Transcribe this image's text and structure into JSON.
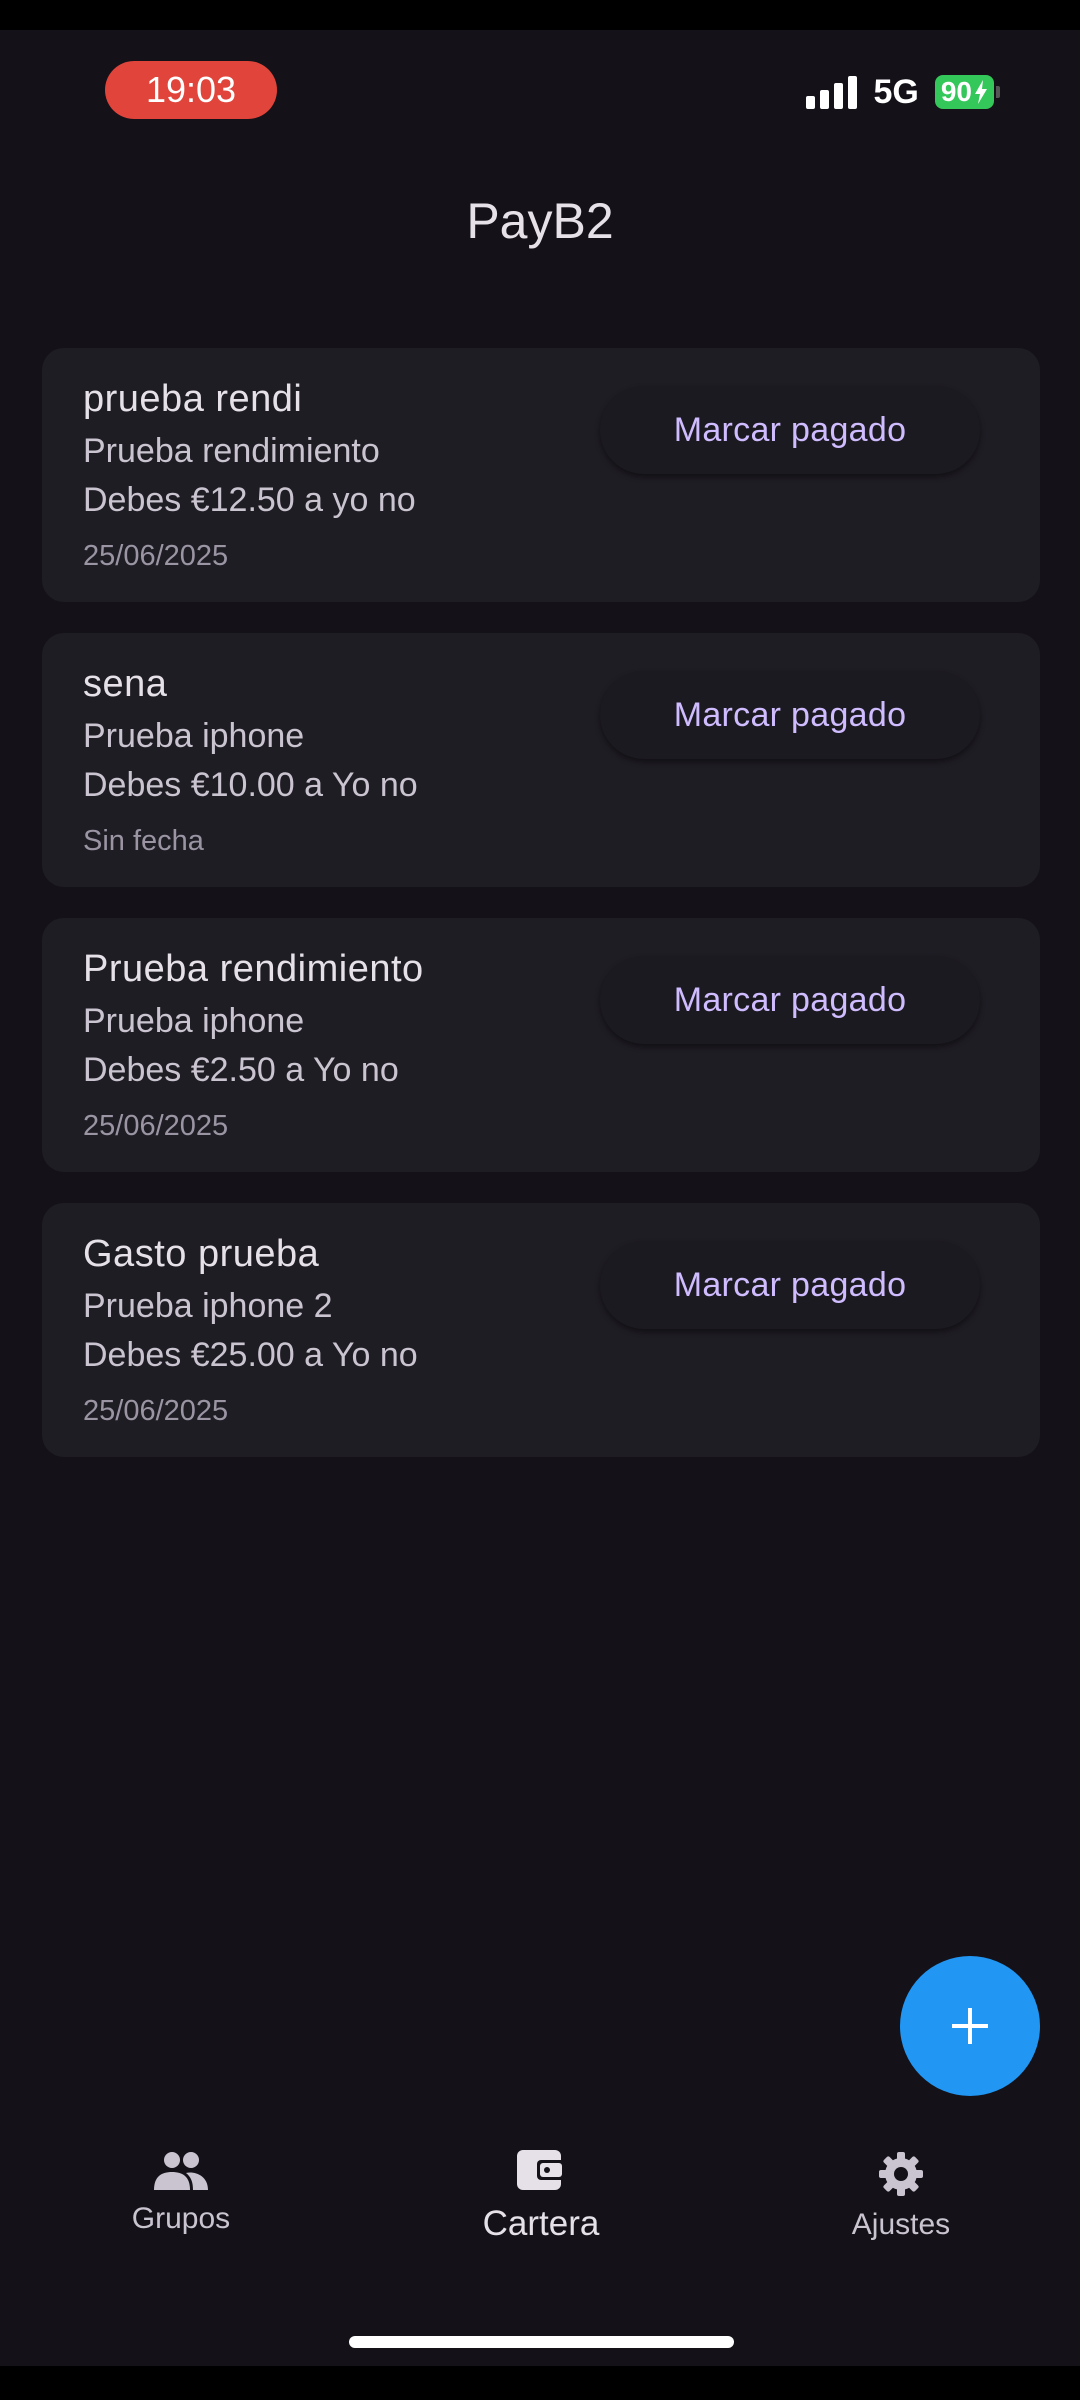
{
  "status_bar": {
    "time": "19:03",
    "network": "5G",
    "battery": "90"
  },
  "app": {
    "title": "PayB2"
  },
  "debts": [
    {
      "title": "prueba rendi",
      "subtitle": "Prueba rendimiento",
      "debt": "Debes €12.50 a yo no",
      "date": "25/06/2025",
      "action": "Marcar pagado"
    },
    {
      "title": "sena",
      "subtitle": "Prueba iphone",
      "debt": "Debes €10.00 a Yo no",
      "date": "Sin fecha",
      "action": "Marcar pagado"
    },
    {
      "title": "Prueba rendimiento",
      "subtitle": "Prueba iphone",
      "debt": "Debes €2.50 a Yo no",
      "date": "25/06/2025",
      "action": "Marcar pagado"
    },
    {
      "title": "Gasto prueba",
      "subtitle": "Prueba iphone 2",
      "debt": "Debes €25.00 a Yo no",
      "date": "25/06/2025",
      "action": "Marcar pagado"
    }
  ],
  "fab": {
    "icon": "add-icon"
  },
  "nav": {
    "items": [
      {
        "label": "Grupos",
        "icon": "groups-icon",
        "active": false
      },
      {
        "label": "Cartera",
        "icon": "wallet-icon",
        "active": true
      },
      {
        "label": "Ajustes",
        "icon": "settings-icon",
        "active": false
      }
    ]
  },
  "colors": {
    "background": "#141218",
    "card": "#1f1d24",
    "accent_text": "#cfbcff",
    "fab": "#2196f3",
    "time_pill": "#e0443b",
    "battery": "#34c759"
  }
}
